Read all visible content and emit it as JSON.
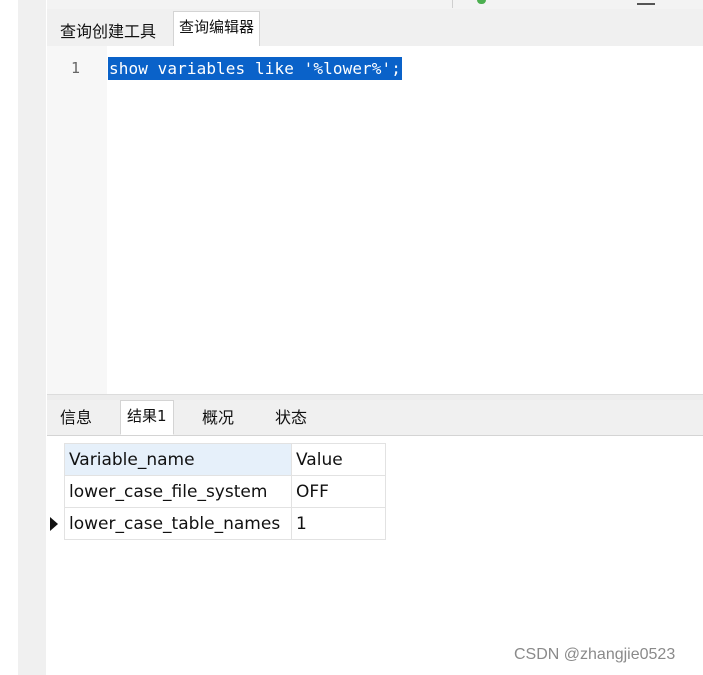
{
  "editor_tabs": [
    {
      "label": "查询创建工具",
      "active": false
    },
    {
      "label": "查询编辑器",
      "active": true
    }
  ],
  "editor": {
    "line_number": "1",
    "code": "show variables like '%lower%';",
    "selection_color": "#0a62c9"
  },
  "result_tabs": [
    {
      "label": "信息",
      "active": false
    },
    {
      "label": "结果1",
      "active": true
    },
    {
      "label": "概况",
      "active": false
    },
    {
      "label": "状态",
      "active": false
    }
  ],
  "grid": {
    "columns": [
      "Variable_name",
      "Value"
    ],
    "rows": [
      [
        "lower_case_file_system",
        "OFF"
      ],
      [
        "lower_case_table_names",
        "1"
      ]
    ],
    "current_row": 2
  },
  "watermark": "CSDN @zhangjie0523",
  "colors": {
    "header_highlight": "#e6f0fa",
    "panel_bg": "#f0f0f0"
  }
}
